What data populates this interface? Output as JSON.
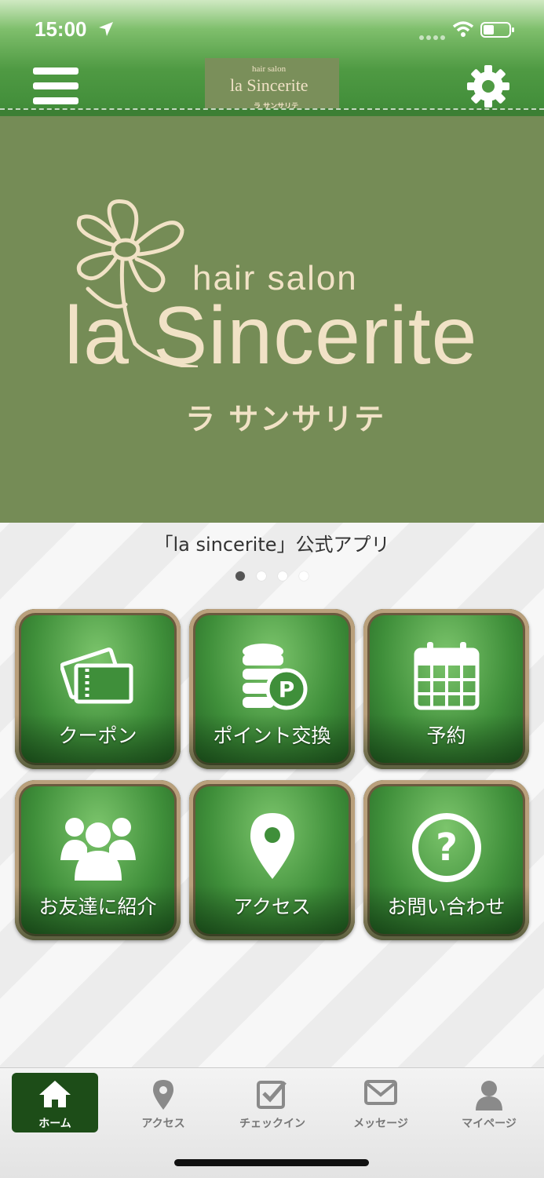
{
  "status_bar": {
    "time": "15:00"
  },
  "header": {
    "logo_line1": "hair salon",
    "logo_line2": "la Sincerite",
    "logo_line3": "ラ サンサリテ"
  },
  "banner": {
    "hair_salon": "hair salon",
    "name": "la Sincerite",
    "kana": "ラ サンサリテ",
    "caption": "「la sincerite」公式アプリ",
    "slide_count": 4,
    "active_slide": 1
  },
  "tiles": [
    {
      "label": "クーポン",
      "icon": "ticket-icon"
    },
    {
      "label": "ポイント交換",
      "icon": "coins-point-icon"
    },
    {
      "label": "予約",
      "icon": "calendar-icon"
    },
    {
      "label": "お友達に紹介",
      "icon": "users-icon"
    },
    {
      "label": "アクセス",
      "icon": "map-pin-icon"
    },
    {
      "label": "お問い合わせ",
      "icon": "question-icon"
    }
  ],
  "tabbar": [
    {
      "label": "ホーム",
      "icon": "home-icon",
      "active": true
    },
    {
      "label": "アクセス",
      "icon": "map-pin-icon",
      "active": false
    },
    {
      "label": "チェックイン",
      "icon": "checkbox-icon",
      "active": false
    },
    {
      "label": "メッセージ",
      "icon": "mail-icon",
      "active": false
    },
    {
      "label": "マイページ",
      "icon": "person-icon",
      "active": false
    }
  ],
  "colors": {
    "header_green": "#4f9a43",
    "banner_bg": "#758c56",
    "banner_text": "#f1e2c6",
    "tab_active": "#1d4d18"
  }
}
